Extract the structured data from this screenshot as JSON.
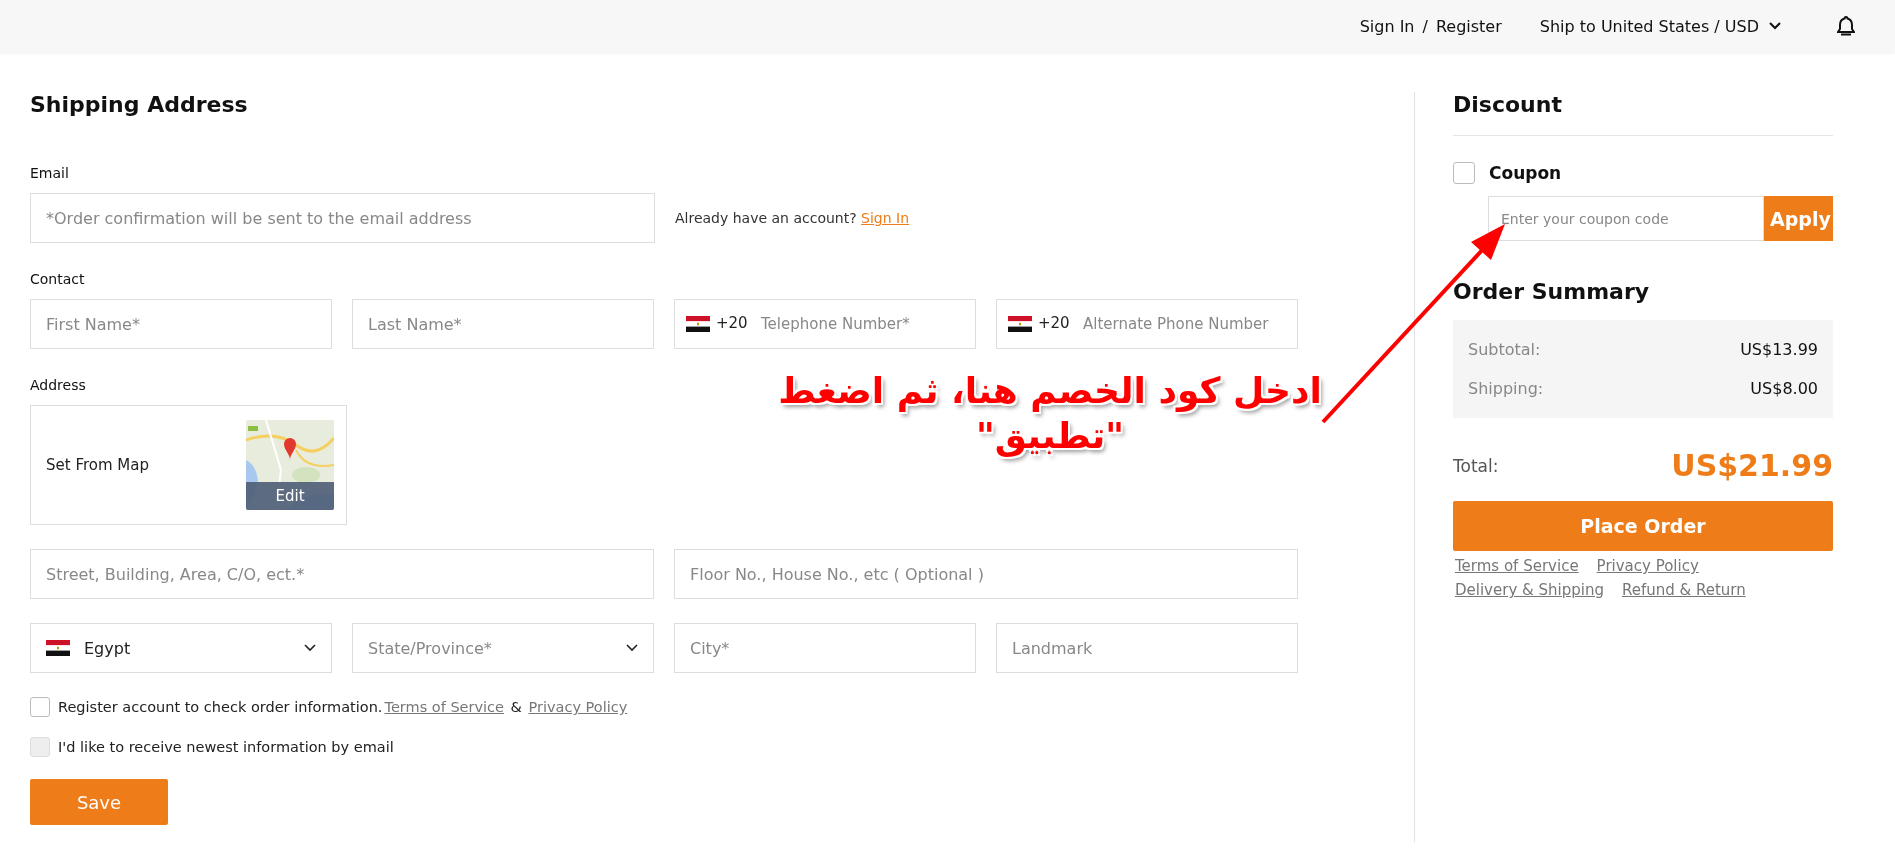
{
  "header": {
    "sign_in": "Sign In",
    "separator": "/",
    "register": "Register",
    "ship_to": "Ship to United States / USD"
  },
  "shipping": {
    "title": "Shipping Address",
    "email": {
      "label": "Email",
      "placeholder": "*Order confirmation will be sent to the email address",
      "account_prompt": "Already have an account?",
      "sign_in_link": "Sign In"
    },
    "contact": {
      "label": "Contact",
      "fields": [
        {
          "kind": "text",
          "placeholder": "First Name*"
        },
        {
          "kind": "text",
          "placeholder": "Last Name*"
        },
        {
          "kind": "phone",
          "code": "+20",
          "placeholder": "Telephone Number*"
        },
        {
          "kind": "phone",
          "code": "+20",
          "placeholder": "Alternate Phone Number"
        }
      ]
    },
    "address": {
      "label": "Address",
      "map": {
        "label": "Set From Map",
        "button": "Edit"
      },
      "street_fields": [
        {
          "placeholder": "Street, Building, Area, C/O, ect.*"
        },
        {
          "placeholder": "Floor No., House No., etc ( Optional )"
        }
      ],
      "region_fields": [
        {
          "kind": "country",
          "value": "Egypt"
        },
        {
          "kind": "select",
          "placeholder": "State/Province*"
        },
        {
          "kind": "text",
          "placeholder": "City*"
        },
        {
          "kind": "text",
          "placeholder": "Landmark"
        }
      ]
    },
    "options": [
      {
        "checked": false,
        "disabled": false,
        "text": "Register account to check order information.",
        "link1": "Terms of Service",
        "joiner": "&",
        "link2": "Privacy Policy"
      },
      {
        "checked": false,
        "disabled": true,
        "text": "I'd like to receive newest information by email"
      }
    ],
    "save": "Save"
  },
  "discount": {
    "title": "Discount",
    "coupon": {
      "label": "Coupon",
      "checked": false,
      "placeholder": "Enter your coupon code",
      "button": "Apply"
    }
  },
  "summary": {
    "title": "Order Summary",
    "rows": [
      {
        "label": "Subtotal:",
        "value": "US$13.99"
      },
      {
        "label": "Shipping:",
        "value": "US$8.00"
      }
    ],
    "total_label": "Total:",
    "total": "US$21.99",
    "place_order": "Place Order",
    "links": [
      [
        "Terms of Service",
        "Privacy Policy"
      ],
      [
        "Delivery & Shipping",
        "Refund & Return"
      ]
    ]
  },
  "annotation": {
    "text": "ادخل كود الخصم هنا، ثم اضغط\n\"تطبيق\""
  }
}
